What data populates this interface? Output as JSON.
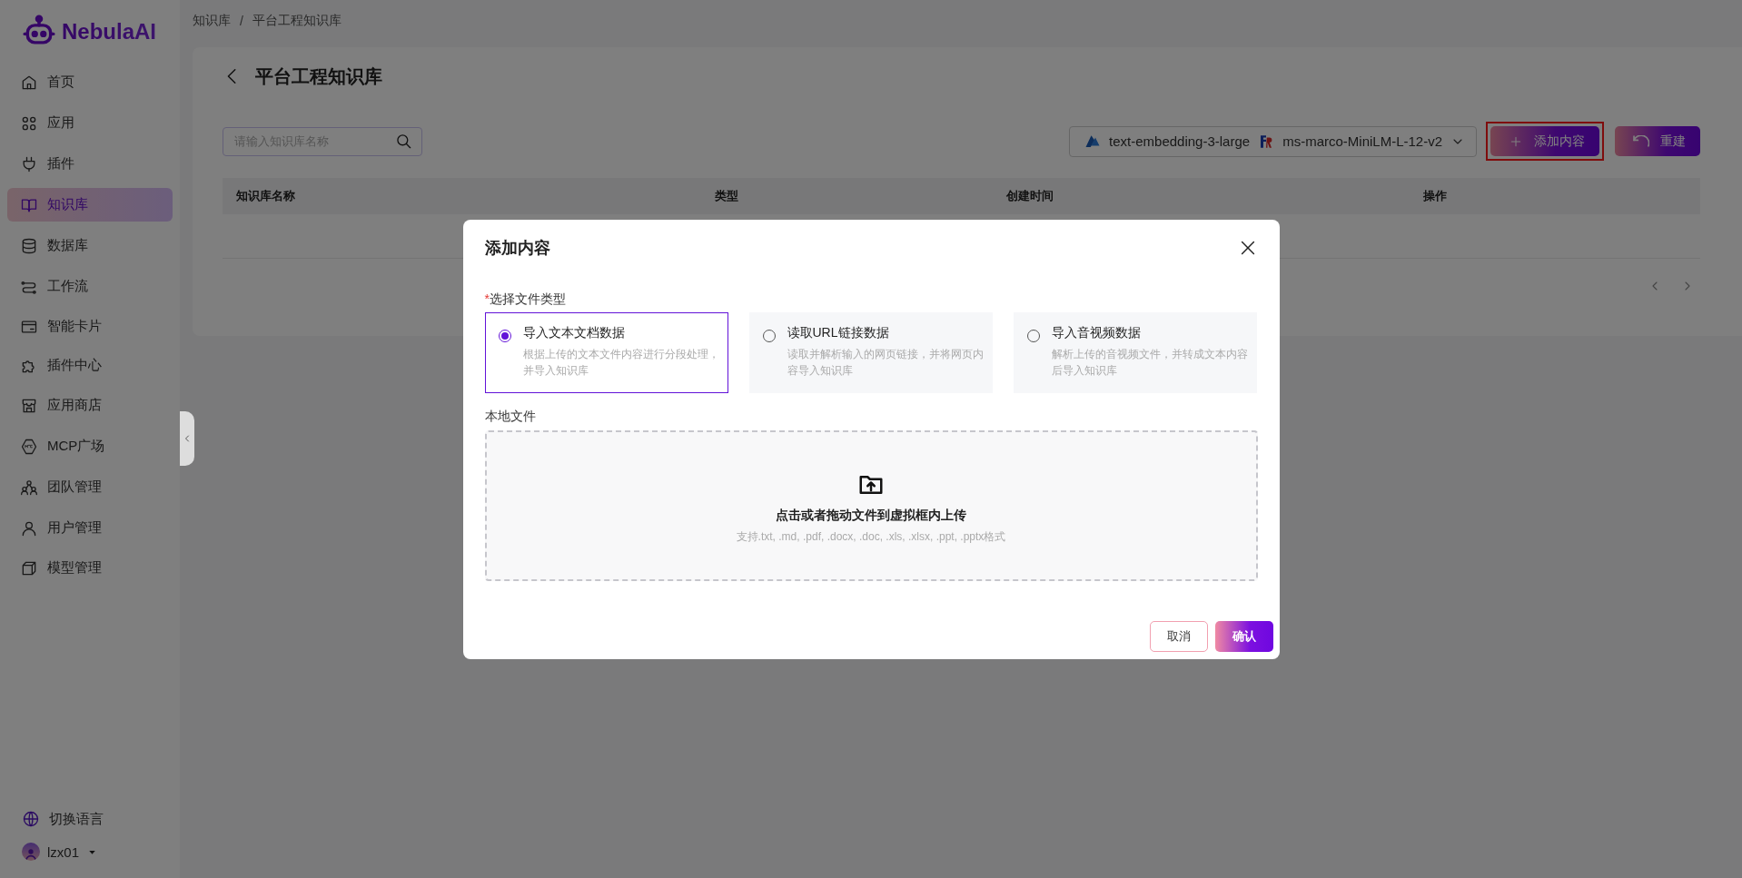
{
  "sidebar": {
    "logo": "NebulaAI",
    "items": [
      {
        "label": "首页",
        "selected": false
      },
      {
        "label": "应用",
        "selected": false
      },
      {
        "label": "插件",
        "selected": false
      },
      {
        "label": "知识库",
        "selected": true
      },
      {
        "label": "数据库",
        "selected": false
      },
      {
        "label": "工作流",
        "selected": false
      },
      {
        "label": "智能卡片",
        "selected": false
      },
      {
        "label": "插件中心",
        "selected": false
      },
      {
        "label": "应用商店",
        "selected": false
      },
      {
        "label": "MCP广场",
        "selected": false
      },
      {
        "label": "团队管理",
        "selected": false
      },
      {
        "label": "用户管理",
        "selected": false
      },
      {
        "label": "模型管理",
        "selected": false
      }
    ],
    "language": "切换语言",
    "user": {
      "name": "lzx01"
    }
  },
  "breadcrumb": {
    "items": [
      "知识库",
      "平台工程知识库"
    ],
    "separator": "/"
  },
  "page": {
    "title": "平台工程知识库",
    "search": {
      "placeholder": "请输入知识库名称"
    },
    "models": {
      "embedding": "text-embedding-3-large",
      "rerank": "ms-marco-MiniLM-L-12-v2"
    },
    "buttons": [
      {
        "label": "添加内容",
        "kind": "add",
        "highlighted": true
      },
      {
        "label": "重建",
        "kind": "rebuild",
        "highlighted": false
      }
    ]
  },
  "table": {
    "columns": [
      "知识库名称",
      "类型",
      "创建时间",
      "操作"
    ]
  },
  "dialog": {
    "title": "添加内容",
    "type_label": "选择文件类型",
    "required_mark": "*",
    "options": [
      {
        "title": "导入文本文档数据",
        "description": "根据上传的文本文件内容进行分段处理，并导入知识库",
        "selected": true
      },
      {
        "title": "读取URL链接数据",
        "description": "读取并解析输入的网页链接，并将网页内容导入知识库",
        "selected": false
      },
      {
        "title": "导入音视频数据",
        "description": "解析上传的音视频文件，并转成文本内容后导入知识库",
        "selected": false
      }
    ],
    "file_label": "本地文件",
    "upload": {
      "text": "点击或者拖动文件到虚拟框内上传",
      "hint": "支持.txt, .md, .pdf, .docx, .doc, .xls, .xlsx, .ppt, .pptx格式"
    },
    "buttons": [
      {
        "label": "取消",
        "kind": "secondary"
      },
      {
        "label": "确认",
        "kind": "primary"
      }
    ]
  }
}
